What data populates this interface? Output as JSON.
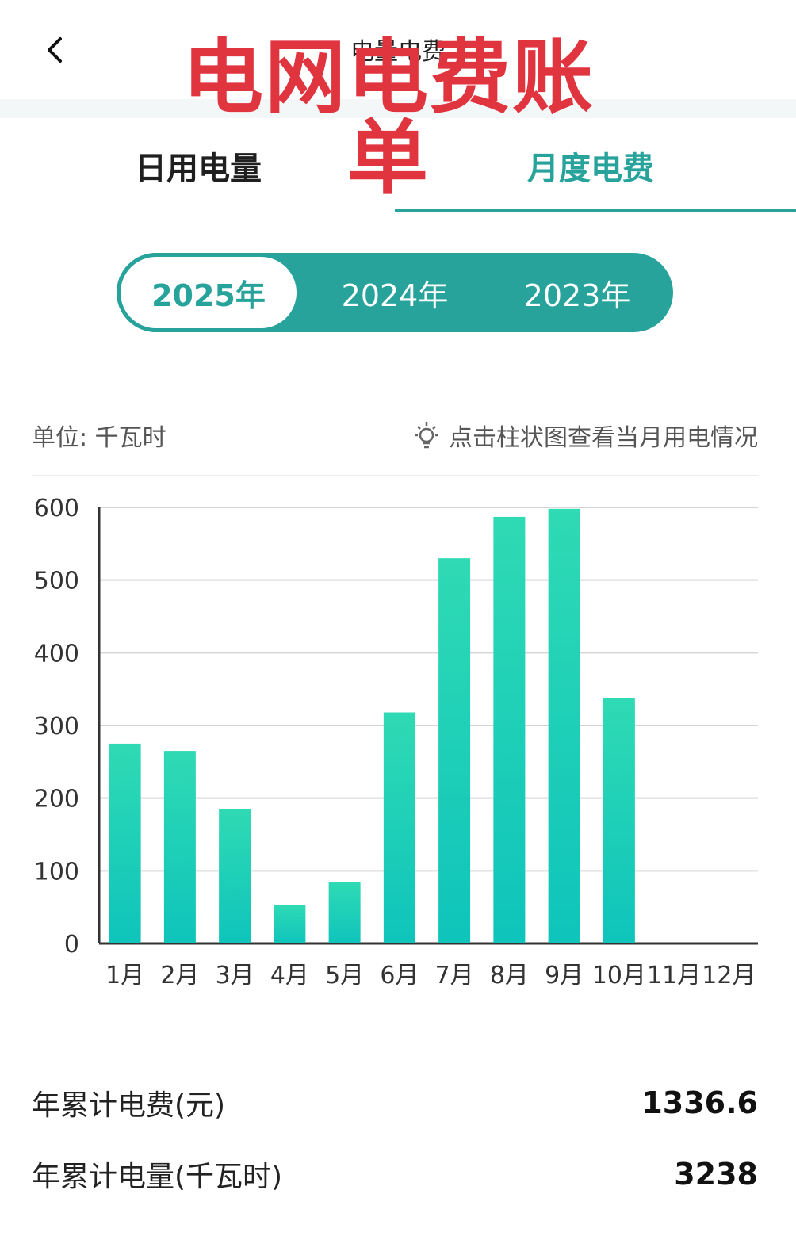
{
  "header": {
    "title": "电量电费",
    "overlay_title": "电网电费账单"
  },
  "tabs": [
    {
      "label": "日用电量",
      "active": false
    },
    {
      "label": "月度电费",
      "active": true
    }
  ],
  "years": [
    {
      "label": "2025年",
      "active": true
    },
    {
      "label": "2024年",
      "active": false
    },
    {
      "label": "2023年",
      "active": false
    }
  ],
  "unit_label": "单位:  千瓦时",
  "hint_label": "点击柱状图查看当月用电情况",
  "colors": {
    "accent": "#27a39c",
    "bar_top": "#2fdab4",
    "bar_bottom": "#0ec4bb",
    "overlay_red": "#e0343f"
  },
  "chart_data": {
    "type": "bar",
    "categories": [
      "1月",
      "2月",
      "3月",
      "4月",
      "5月",
      "6月",
      "7月",
      "8月",
      "9月",
      "10月",
      "11月",
      "12月"
    ],
    "values": [
      275,
      265,
      185,
      53,
      85,
      318,
      530,
      587,
      598,
      338,
      null,
      null
    ],
    "ylim": [
      0,
      600
    ],
    "yticks": [
      0,
      100,
      200,
      300,
      400,
      500,
      600
    ],
    "grid": true,
    "xlabel": "",
    "ylabel": ""
  },
  "summary": {
    "cost_label": "年累计电费(元)",
    "cost_value": "1336.6",
    "energy_label": "年累计电量(千瓦时)",
    "energy_value": "3238"
  }
}
